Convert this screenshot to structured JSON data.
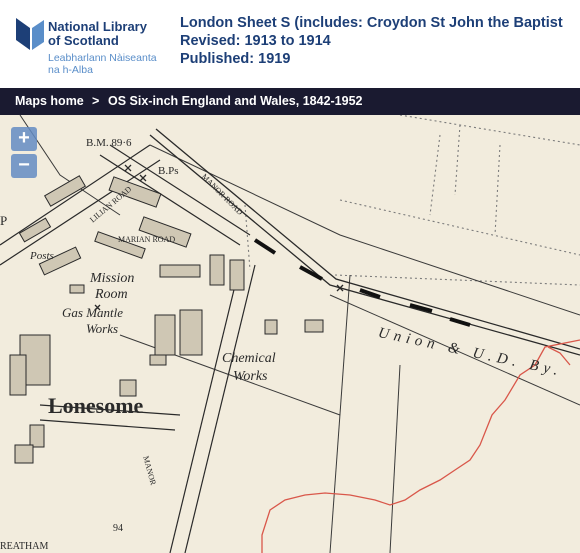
{
  "header": {
    "logo_line1": "National Library",
    "logo_line2": "of Scotland",
    "logo_gaelic1": "Leabharlann Nàiseanta",
    "logo_gaelic2": "na h-Alba",
    "title": "London Sheet S (includes: Croydon St John the Baptist",
    "revised": "Revised: 1913 to 1914",
    "published": "Published: 1919"
  },
  "nav": {
    "home": "Maps home",
    "separator": ">",
    "series": "OS Six-inch England and Wales, 1842-1952"
  },
  "zoom": {
    "in": "+",
    "out": "−"
  },
  "map": {
    "labels": {
      "bm": "B.M. 89·6",
      "bps": "B.Ps",
      "mission": "Mission",
      "room": "Room",
      "gas": "Gas Mantle",
      "works1": "Works",
      "chemical": "Chemical",
      "works2": "Works",
      "lonesome": "Lonesome",
      "union": "Union & U.D. By.",
      "posts": "Posts",
      "marian": "MARIAN ROAD",
      "lilian": "LILIAN ROAD",
      "manor_top": "MANOR ROAD",
      "manor_bottom": "MANOR",
      "streatham": "REATHAM",
      "num": "94",
      "p": "P"
    },
    "colors": {
      "paper": "#f2ecdd",
      "ink": "#2a2a2a",
      "boundary": "#d9574a"
    }
  }
}
